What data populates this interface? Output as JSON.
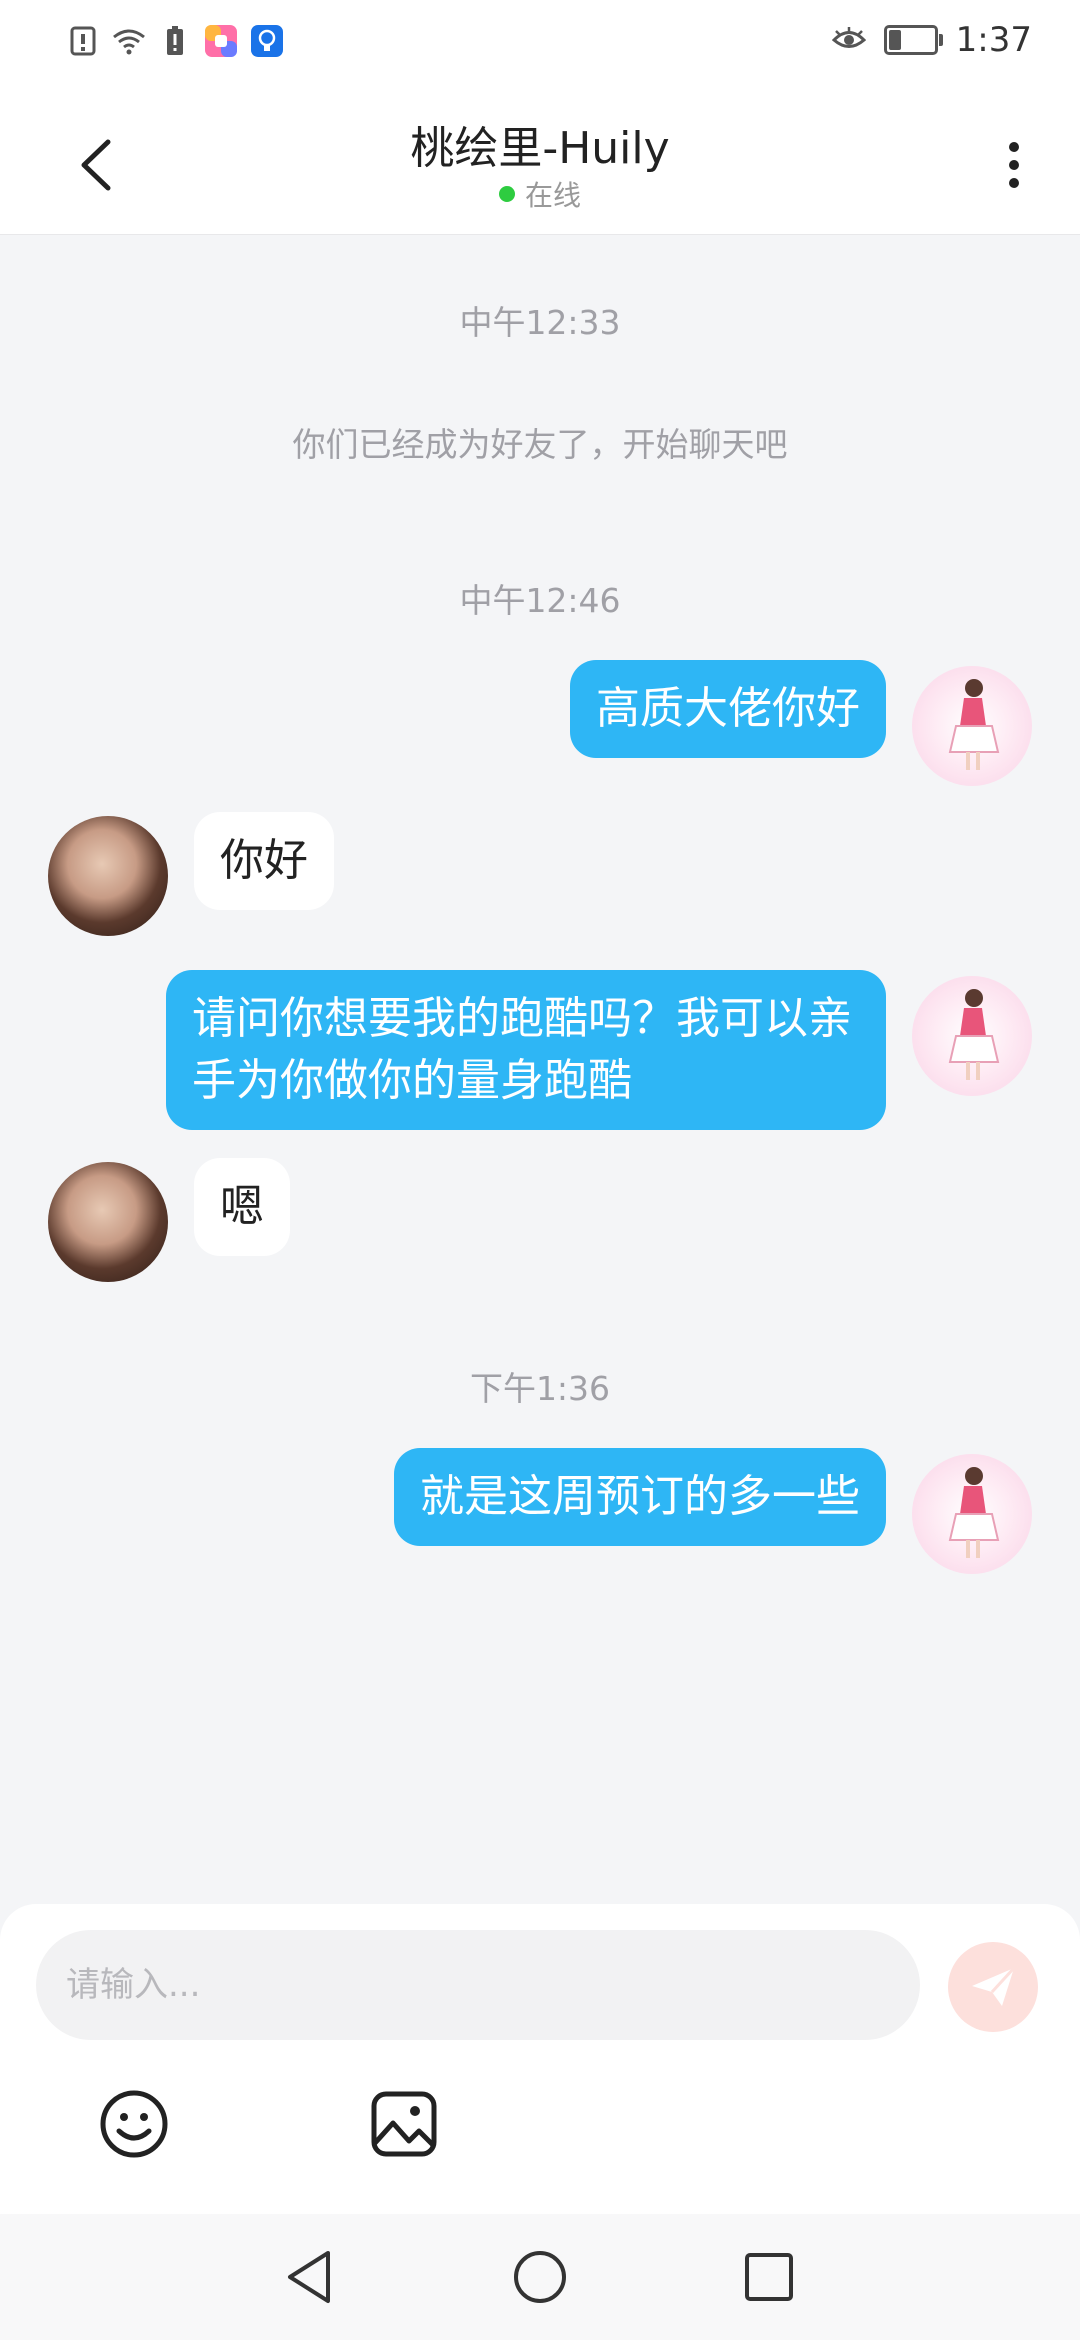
{
  "status_bar": {
    "time": "1:37",
    "icons": [
      "alert-icon",
      "wifi-icon",
      "alert-battery-icon",
      "app-icon-colorful",
      "app-icon-blue-bulb",
      "eye-icon",
      "battery-icon"
    ]
  },
  "header": {
    "title": "桃绘里-Huily",
    "status": "在线",
    "status_color": "#2ecc40"
  },
  "chat": {
    "messages": [
      {
        "type": "timestamp",
        "text": "中午12:33"
      },
      {
        "type": "system",
        "text": "你们已经成为好友了，开始聊天吧"
      },
      {
        "type": "timestamp",
        "text": "中午12:46"
      },
      {
        "type": "me",
        "text": "高质大佬你好"
      },
      {
        "type": "them",
        "text": "你好"
      },
      {
        "type": "me",
        "text": "请问你想要我的跑酷吗？我可以亲手为你做你的量身跑酷"
      },
      {
        "type": "them",
        "text": "嗯"
      },
      {
        "type": "timestamp",
        "text": "下午1:36"
      },
      {
        "type": "me",
        "text": "就是这周预订的多一些"
      }
    ]
  },
  "input": {
    "placeholder": "请输入..."
  },
  "toolbar": {
    "items": [
      "emoji-icon",
      "image-icon"
    ]
  },
  "colors": {
    "my_bubble": "#2eb6f5",
    "their_bubble": "#ffffff",
    "send_button": "#fde0dc",
    "background": "#f4f5f7"
  }
}
